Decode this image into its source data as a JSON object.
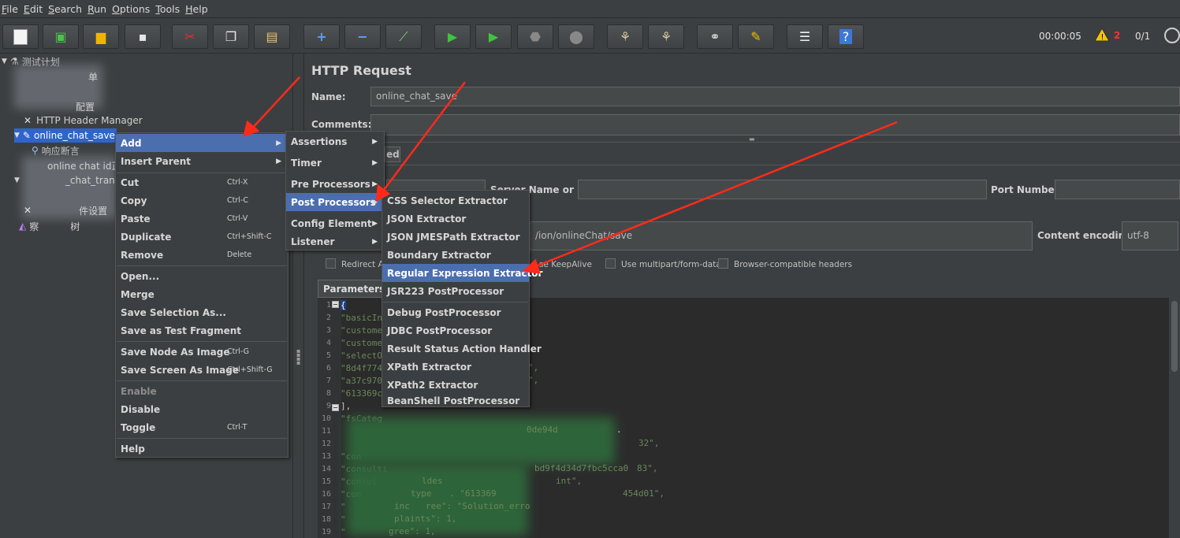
{
  "menubar": [
    "File",
    "Edit",
    "Search",
    "Run",
    "Options",
    "Tools",
    "Help"
  ],
  "toolbar": {
    "elapsed": "00:00:05",
    "error_count": "2",
    "threads": "0/1",
    "buttons": [
      "new-icon",
      "templates-icon",
      "open-icon",
      "save-icon",
      "cut-icon",
      "copy-icon",
      "paste-icon",
      "expand-icon",
      "collapse-icon",
      "toggle-icon",
      "start-icon",
      "start-no-pause-icon",
      "stop-icon",
      "shutdown-icon",
      "clear-icon",
      "clear-all-icon",
      "search-icon",
      "reset-search-icon",
      "function-helper-icon",
      "help-icon"
    ]
  },
  "tree": {
    "root": "测试计划",
    "thread_group_partial": "单",
    "item_config_partial": "配置",
    "header_manager": "HTTP Header Manager",
    "selected": "online_chat_save",
    "assertion": "响应断言",
    "id_partial": "online chat id正",
    "tran_partial": "_chat_tran",
    "setting_partial": "件设置",
    "listener_partial": "察",
    "listener_partial2": "树"
  },
  "panel": {
    "title": "HTTP Request",
    "name_label": "Name:",
    "name_value": "online_chat_save",
    "comments_label": "Comments:",
    "advanced_tab_partial": "ed",
    "server_label": "Server Name or IP:",
    "port_label": "Port Number:",
    "path_partial": "/ion/onlineChat/save",
    "encoding_label": "Content encoding:",
    "encoding_value": "utf-8",
    "redirect_partial": "Redirect A",
    "keepalive_partial": "se KeepAlive",
    "multipart": "Use multipart/form-data",
    "browser_headers": "Browser-compatible headers",
    "params_tab": "Parameters"
  },
  "code": {
    "line_numbers": [
      "1",
      "2",
      "3",
      "4",
      "5",
      "6",
      "7",
      "8",
      "9",
      "10",
      "11",
      "12",
      "13",
      "14",
      "15",
      "16",
      "17",
      "18",
      "19"
    ],
    "lines": [
      "{",
      "\"basicIn",
      "\"custome",
      "\"custome",
      "\"selectO",
      "\"8d4f774",
      "\"a37c970",
      "\"613369c",
      "],",
      "\"fsCateg",
      "",
      "",
      "\"con",
      "\"consulti",
      "\"consul",
      "\"con",
      "\"",
      "\"",
      "\""
    ],
    "fragments": {
      "l6": "\",",
      "l7": "\",",
      "l11": "0de94d",
      "l12": "32\",",
      "l14": "bd9f4d34d7fbc5cca0",
      "l14b": "83\",",
      "l15": "ldes",
      "l15b": "int\",",
      "l16": "type",
      "l16b": ". \"613369",
      "l16c": "454d01\",",
      "l17": "inc",
      "l17b": "ree\": \"Solution_erro",
      "l18": "plaints\": 1,",
      "l19": "gree\": 1,"
    }
  },
  "context_menu": {
    "items": [
      {
        "label": "Add",
        "submenu": true,
        "highlight": true
      },
      {
        "label": "Insert Parent",
        "submenu": true
      },
      {
        "label": "Cut",
        "shortcut": "Ctrl-X"
      },
      {
        "label": "Copy",
        "shortcut": "Ctrl-C"
      },
      {
        "label": "Paste",
        "shortcut": "Ctrl-V"
      },
      {
        "label": "Duplicate",
        "shortcut": "Ctrl+Shift-C"
      },
      {
        "label": "Remove",
        "shortcut": "Delete"
      },
      {
        "label": "Open..."
      },
      {
        "label": "Merge"
      },
      {
        "label": "Save Selection As..."
      },
      {
        "label": "Save as Test Fragment"
      },
      {
        "label": "Save Node As Image",
        "shortcut": "Ctrl-G"
      },
      {
        "label": "Save Screen As Image",
        "shortcut": "Ctrl+Shift-G"
      },
      {
        "label": "Enable",
        "disabled": true
      },
      {
        "label": "Disable"
      },
      {
        "label": "Toggle",
        "shortcut": "Ctrl-T"
      },
      {
        "label": "Help"
      }
    ]
  },
  "add_submenu": [
    "Assertions",
    "Timer",
    "Pre Processors",
    "Post Processors",
    "Config Element",
    "Listener"
  ],
  "post_processors": [
    "CSS Selector Extractor",
    "JSON Extractor",
    "JSON JMESPath Extractor",
    "Boundary Extractor",
    "Regular Expression Extractor",
    "JSR223 PostProcessor",
    "Debug PostProcessor",
    "JDBC PostProcessor",
    "Result Status Action Handler",
    "XPath Extractor",
    "XPath2 Extractor",
    "BeanShell PostProcessor"
  ],
  "colors": {
    "background": "#3c3f41",
    "highlight": "#4b6eaf",
    "selection": "#2f65ca",
    "annotation_arrow": "#ff2a1a"
  }
}
